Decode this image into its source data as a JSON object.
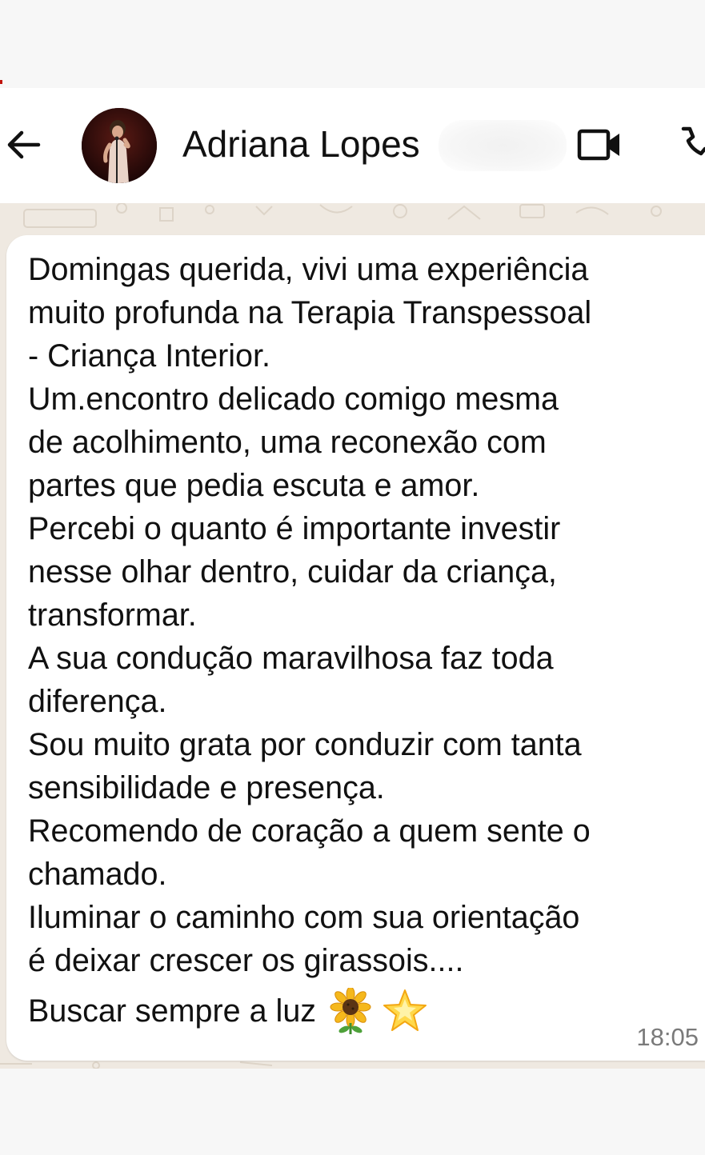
{
  "header": {
    "contact_name": "Adriana Lopes",
    "back_icon": "arrow-left-icon",
    "avatar": "contact-avatar",
    "video_icon": "video-camera-icon",
    "call_icon": "phone-icon"
  },
  "message": {
    "text": "Domingas querida, vivi uma experiência\nmuito profunda na Terapia Transpessoal\n- Criança Interior.\nUm.encontro delicado comigo mesma\nde acolhimento, uma reconexão com\npartes que pedia escuta e amor.\nPercebi o quanto é importante investir\nnesse olhar dentro, cuidar da criança,\ntransformar.\nA sua condução maravilhosa faz toda\ndiferença.\nSou muito grata por conduzir com tanta\nsensibilidade e presença.\nRecomendo de coração a quem sente o\nchamado.\nIluminar o caminho com sua orientação\né deixar crescer os girassois....",
    "last_line": "Buscar sempre a luz",
    "emojis": [
      "sunflower-icon",
      "glowing-star-icon"
    ],
    "time": "18:05"
  },
  "colors": {
    "chat_background": "#efe9e1",
    "bubble": "#ffffff",
    "header": "#ffffff",
    "timestamp": "#7a7a7a"
  }
}
